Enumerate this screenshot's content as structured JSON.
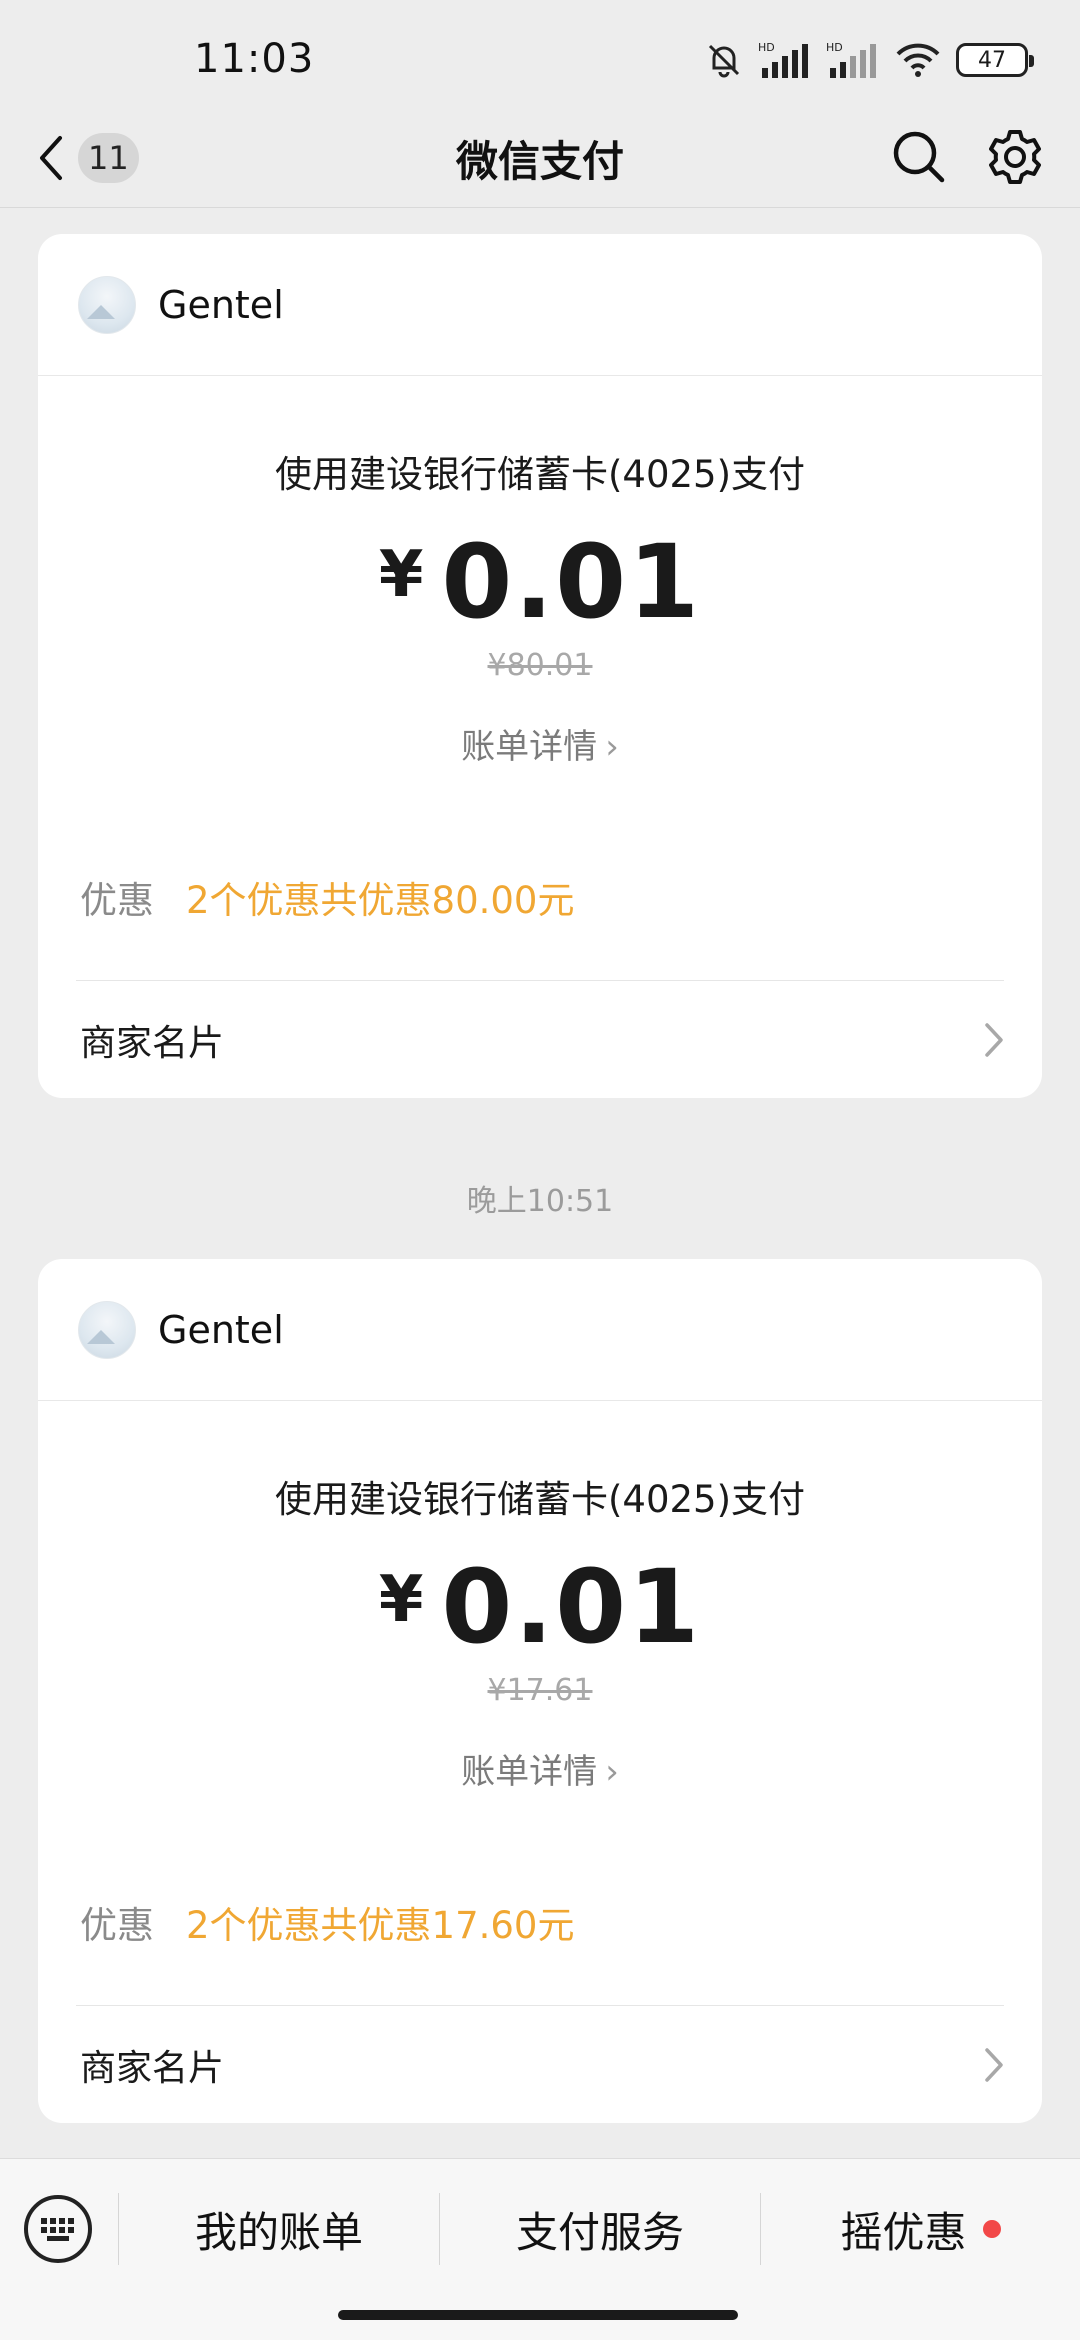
{
  "status_bar": {
    "time": "11:03",
    "battery": "47",
    "icons": [
      "bell-off-icon",
      "signal-hd-icon",
      "signal-hd-icon",
      "wifi-icon",
      "battery-icon"
    ]
  },
  "nav": {
    "back_icon": "chevron-left-icon",
    "unread_count": "11",
    "title": "微信支付",
    "search_icon": "search-icon",
    "settings_icon": "gear-icon"
  },
  "messages": [
    {
      "merchant": "Gentel",
      "pay_method": "使用建设银行储蓄卡(4025)支付",
      "currency": "¥",
      "amount": "0.01",
      "original_amount": "¥80.01",
      "bill_detail": "账单详情",
      "discount_label": "优惠",
      "discount_value": "2个优惠共优惠80.00元",
      "merchant_card": "商家名片"
    },
    {
      "merchant": "Gentel",
      "pay_method": "使用建设银行储蓄卡(4025)支付",
      "currency": "¥",
      "amount": "0.01",
      "original_amount": "¥17.61",
      "bill_detail": "账单详情",
      "discount_label": "优惠",
      "discount_value": "2个优惠共优惠17.60元",
      "merchant_card": "商家名片"
    }
  ],
  "timestamp": "晚上10:51",
  "bottom_bar": {
    "keyboard_icon": "keyboard-icon",
    "items": [
      "我的账单",
      "支付服务",
      "摇优惠"
    ]
  },
  "colors": {
    "background": "#ededed",
    "discount": "#f0a733",
    "badge_dot": "#f24848"
  }
}
